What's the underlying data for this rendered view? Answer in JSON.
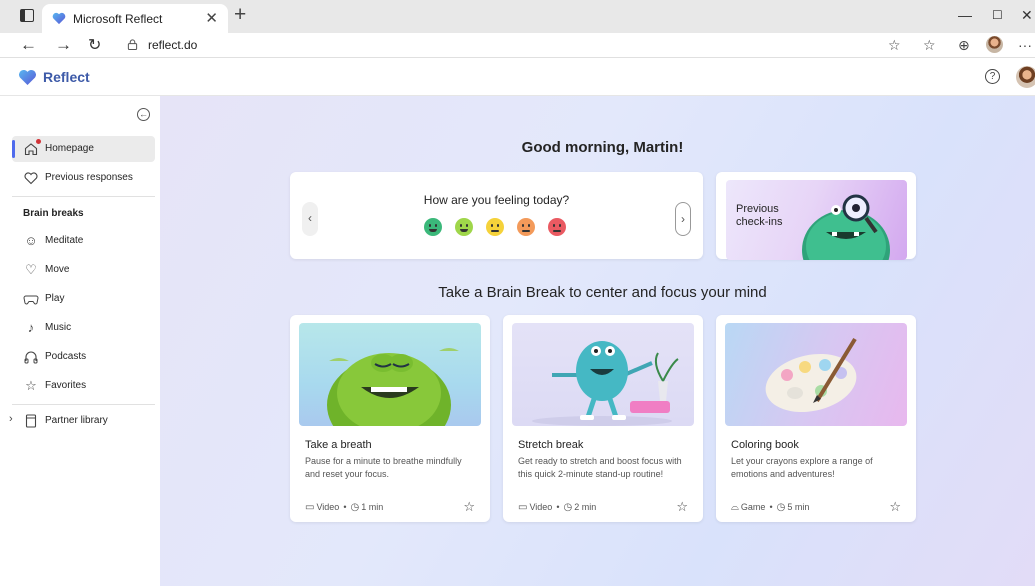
{
  "browser": {
    "tab_title": "Microsoft Reflect",
    "url": "reflect.do"
  },
  "app": {
    "brand": "Reflect",
    "help_icon": "?"
  },
  "sidebar": {
    "items": [
      {
        "label": "Homepage",
        "icon": "home-icon",
        "active": true
      },
      {
        "label": "Previous responses",
        "icon": "heart-icon"
      }
    ],
    "section_title": "Brain breaks",
    "brain_breaks": [
      {
        "label": "Meditate",
        "icon": "meditate-icon"
      },
      {
        "label": "Move",
        "icon": "move-icon"
      },
      {
        "label": "Play",
        "icon": "gamepad-icon"
      },
      {
        "label": "Music",
        "icon": "music-icon"
      },
      {
        "label": "Podcasts",
        "icon": "podcast-icon"
      },
      {
        "label": "Favorites",
        "icon": "star-icon"
      }
    ],
    "partner_library": "Partner library"
  },
  "main": {
    "greeting": "Good morning, Martin!",
    "feeling_question": "How are you feeling today?",
    "emoji_colors": [
      "#3bb87a",
      "#9fd64a",
      "#f5d23a",
      "#f39a5a",
      "#ea5a62"
    ],
    "previous_checkins": "Previous check-ins",
    "subtitle": "Take a Brain Break to center and focus your mind",
    "cards": [
      {
        "title": "Take a breath",
        "desc": "Pause for a minute to breathe mindfully and reset your focus.",
        "type": "Video",
        "duration": "1 min"
      },
      {
        "title": "Stretch break",
        "desc": "Get ready to stretch and boost focus with this quick 2-minute stand-up routine!",
        "type": "Video",
        "duration": "2 min"
      },
      {
        "title": "Coloring book",
        "desc": "Let your crayons explore a range of emotions and adventures!",
        "type": "Game",
        "duration": "5 min"
      }
    ]
  },
  "colors": {
    "accent": "#4f6bed",
    "brand": "#3d5aa8"
  }
}
